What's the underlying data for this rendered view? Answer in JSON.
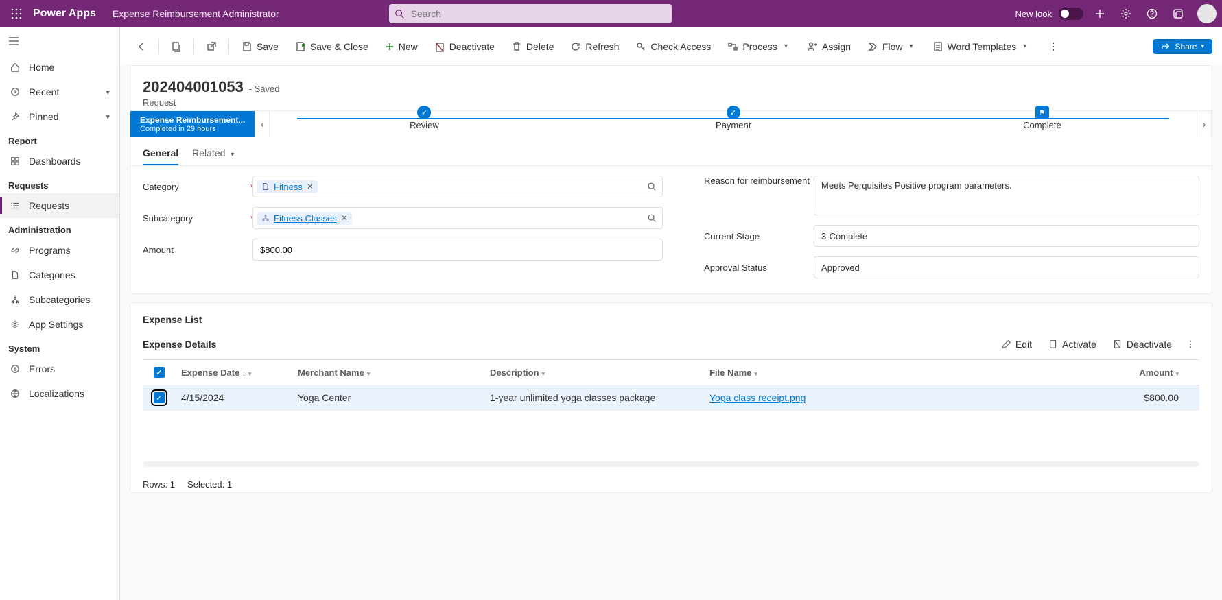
{
  "header": {
    "brand": "Power Apps",
    "app_name": "Expense Reimbursement Administrator",
    "search_placeholder": "Search",
    "new_look_label": "New look"
  },
  "sidebar": {
    "home": "Home",
    "recent": "Recent",
    "pinned": "Pinned",
    "sections": {
      "report": "Report",
      "requests": "Requests",
      "administration": "Administration",
      "system": "System"
    },
    "items": {
      "dashboards": "Dashboards",
      "requests_item": "Requests",
      "programs": "Programs",
      "categories": "Categories",
      "subcategories": "Subcategories",
      "app_settings": "App Settings",
      "errors": "Errors",
      "localizations": "Localizations"
    }
  },
  "commands": {
    "save": "Save",
    "save_close": "Save & Close",
    "new": "New",
    "deactivate": "Deactivate",
    "delete": "Delete",
    "refresh": "Refresh",
    "check_access": "Check Access",
    "process": "Process",
    "assign": "Assign",
    "flow": "Flow",
    "word_templates": "Word Templates",
    "share": "Share"
  },
  "record": {
    "number": "202404001053",
    "saved_suffix": "- Saved",
    "entity": "Request"
  },
  "stages": {
    "process_name": "Expense Reimbursement...",
    "completed_in": "Completed in 29 hours",
    "review": "Review",
    "payment": "Payment",
    "complete": "Complete"
  },
  "tabs": {
    "general": "General",
    "related": "Related"
  },
  "form": {
    "category_label": "Category",
    "category_value": "Fitness",
    "subcategory_label": "Subcategory",
    "subcategory_value": "Fitness Classes",
    "amount_label": "Amount",
    "amount_value": "$800.00",
    "reason_label": "Reason for reimbursement",
    "reason_value": "Meets Perquisites Positive program parameters.",
    "stage_label": "Current Stage",
    "stage_value": "3-Complete",
    "approval_label": "Approval Status",
    "approval_value": "Approved"
  },
  "expense": {
    "section_title": "Expense List",
    "subgrid_title": "Expense Details",
    "actions": {
      "edit": "Edit",
      "activate": "Activate",
      "deactivate": "Deactivate"
    },
    "columns": {
      "date": "Expense Date",
      "merchant": "Merchant Name",
      "description": "Description",
      "file": "File Name",
      "amount": "Amount"
    },
    "rows": [
      {
        "date": "4/15/2024",
        "merchant": "Yoga Center",
        "description": "1-year unlimited yoga classes package",
        "file": "Yoga class receipt.png",
        "amount": "$800.00"
      }
    ],
    "footer_rows_label": "Rows:",
    "footer_rows": "1",
    "footer_selected_label": "Selected:",
    "footer_selected": "1"
  }
}
